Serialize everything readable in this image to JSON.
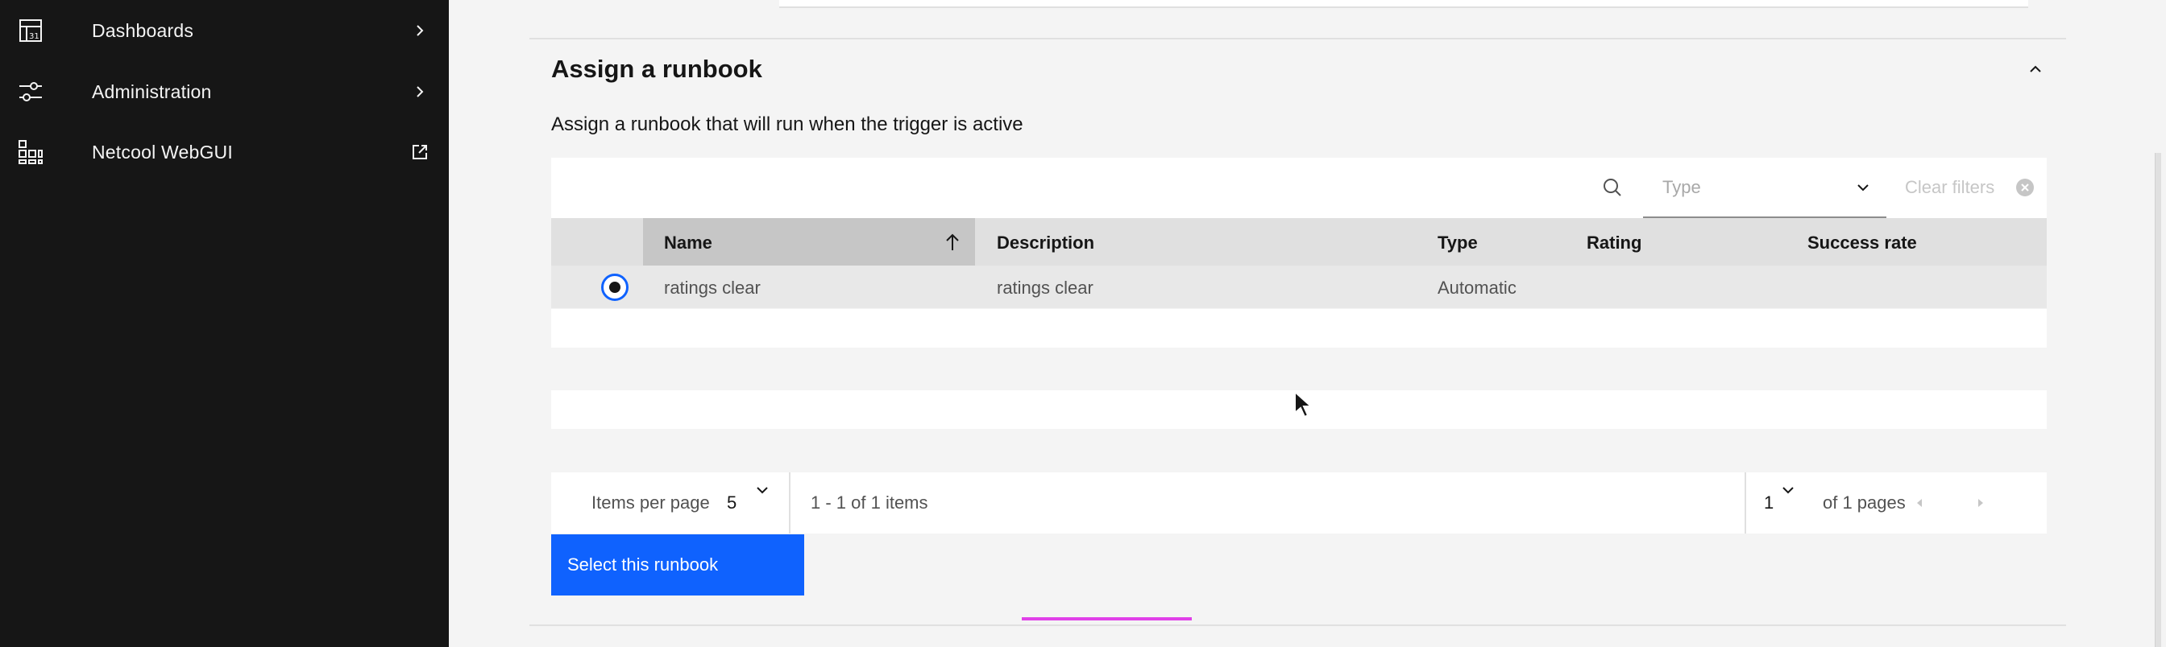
{
  "sidebar": {
    "items": [
      {
        "label": "Dashboards",
        "icon": "dashboard-icon",
        "trail": "chevron-right-icon"
      },
      {
        "label": "Administration",
        "icon": "sliders-icon",
        "trail": "chevron-right-icon"
      },
      {
        "label": "Netcool WebGUI",
        "icon": "grid-apps-icon",
        "trail": "launch-icon"
      }
    ]
  },
  "section": {
    "title": "Assign a runbook",
    "description": "Assign a runbook that will run when the trigger is active"
  },
  "toolbar": {
    "search_icon": "search-icon",
    "type_placeholder": "Type",
    "clear_filters": "Clear filters"
  },
  "table": {
    "headers": [
      "Name",
      "Description",
      "Type",
      "Rating",
      "Success rate"
    ],
    "sort_column": "Name",
    "sort_direction": "ascending",
    "rows": [
      {
        "selected": true,
        "name": "ratings clear",
        "description": "ratings clear",
        "type": "Automatic",
        "rating": "",
        "success_rate": ""
      }
    ]
  },
  "pagination": {
    "items_per_page_label": "Items per page",
    "items_per_page": "5",
    "range": "1 - 1 of 1 items",
    "page": "1",
    "of_pages": "of 1 pages"
  },
  "actions": {
    "select_runbook": "Select this runbook"
  },
  "colors": {
    "sidebar_bg": "#161616",
    "primary": "#0f62fe",
    "highlight_underline": "#e040e8"
  }
}
